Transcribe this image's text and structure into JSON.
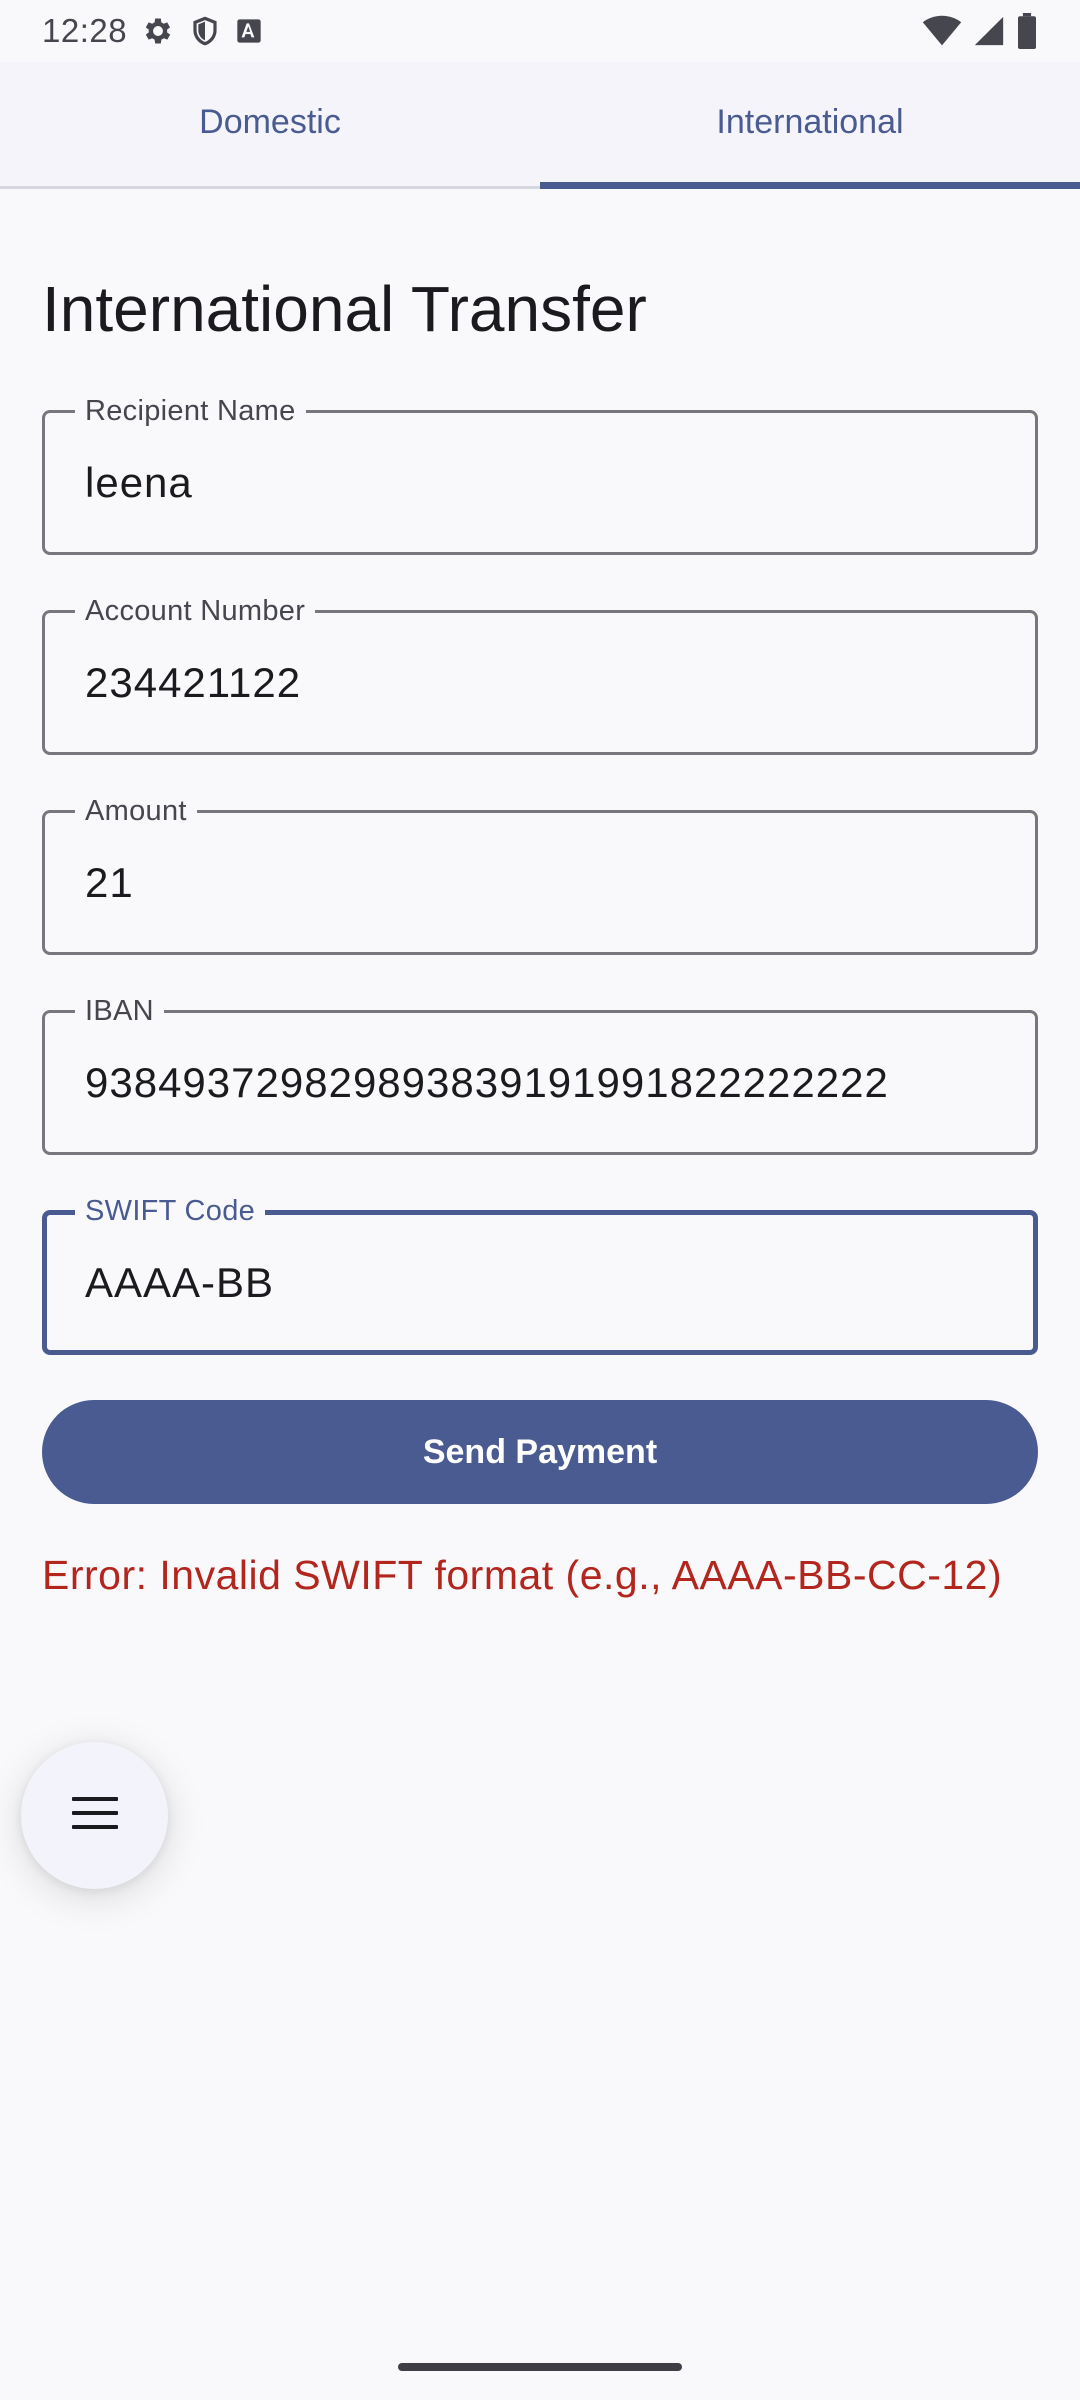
{
  "status_bar": {
    "time": "12:28",
    "left_icons": [
      "gear-icon",
      "shield-icon",
      "a-box-icon"
    ],
    "right_icons": [
      "wifi-icon",
      "cell-signal-icon",
      "battery-icon"
    ]
  },
  "tabs": [
    {
      "label": "Domestic",
      "selected": false
    },
    {
      "label": "International",
      "selected": true
    }
  ],
  "page_title": "International Transfer",
  "fields": [
    {
      "label": "Recipient Name",
      "value": "leena",
      "focused": false
    },
    {
      "label": "Account Number",
      "value": "234421122",
      "focused": false
    },
    {
      "label": "Amount",
      "value": "21",
      "focused": false
    },
    {
      "label": "IBAN",
      "value": "938493729829893839191991822222222",
      "focused": false
    },
    {
      "label": "SWIFT Code",
      "value": "AAAA-BB",
      "focused": true
    }
  ],
  "send_button_label": "Send Payment",
  "error_message": "Error: Invalid SWIFT format (e.g., AAAA-BB-CC-12)",
  "fab_icon": "menu-icon",
  "colors": {
    "primary": "#4a5b91",
    "error": "#b3261e",
    "background": "#f9f9fb"
  }
}
